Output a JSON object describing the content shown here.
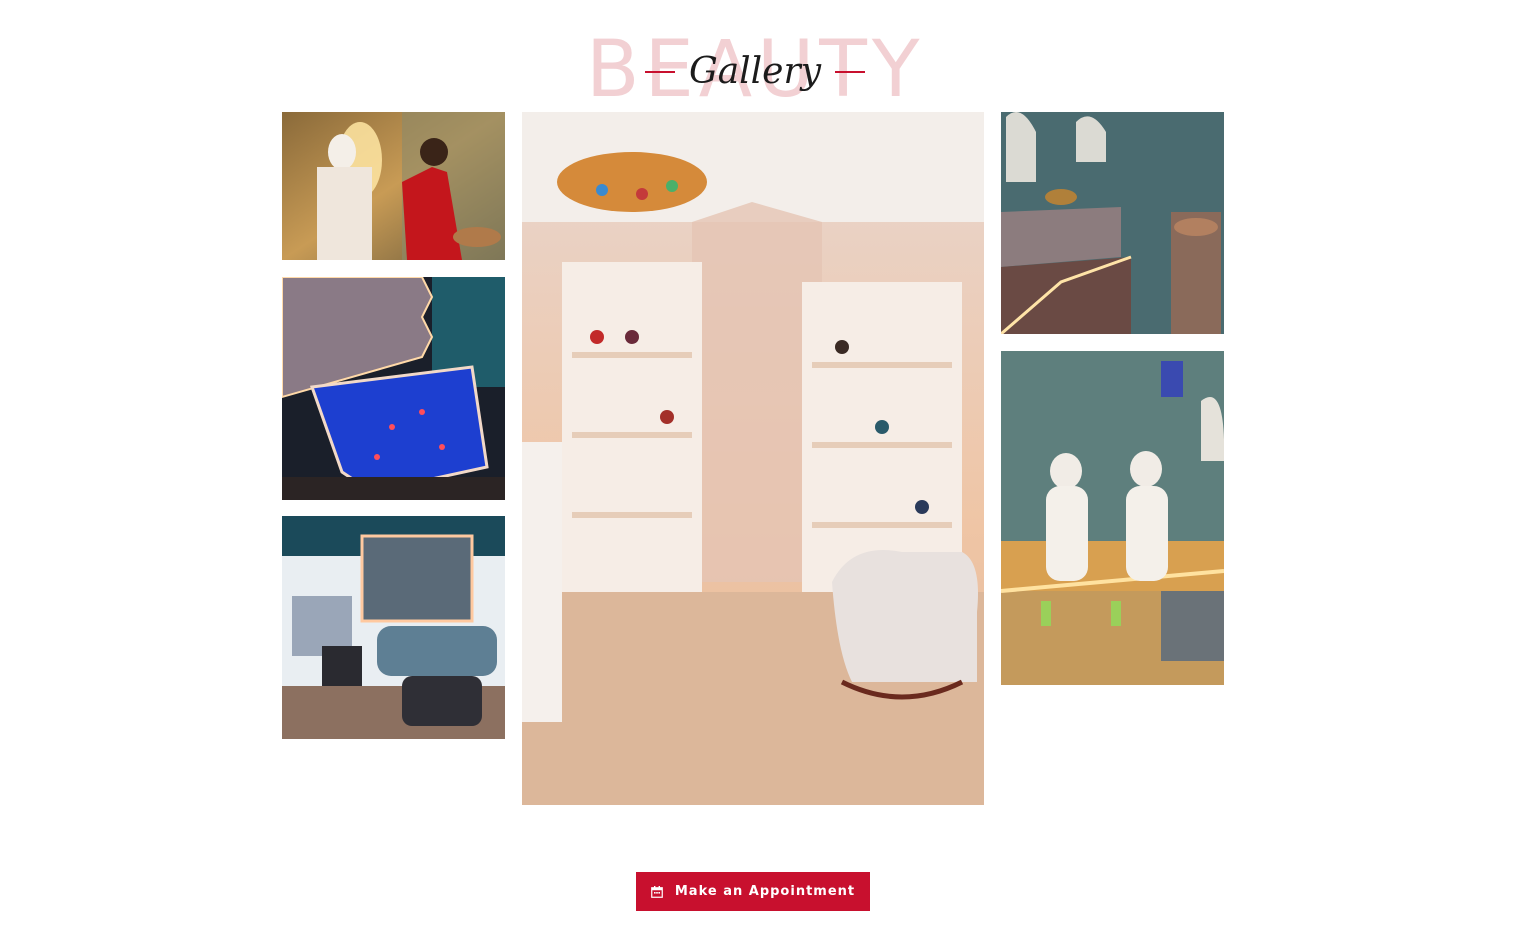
{
  "section": {
    "background_word": "BEAUTY",
    "title": "Gallery"
  },
  "gallery": {
    "images": [
      {
        "name": "treatment-massage-photo",
        "accent": "#b8752c"
      },
      {
        "name": "pool-photo",
        "accent": "#1f3fc8"
      },
      {
        "name": "facial-room-photo",
        "accent": "#4a7fa3"
      },
      {
        "name": "shop-lounge-photo",
        "accent": "#f2c7a3"
      },
      {
        "name": "hammam-room-photo",
        "accent": "#3f6d73"
      },
      {
        "name": "hammam-guests-photo",
        "accent": "#e6b64a"
      }
    ]
  },
  "cta": {
    "label": "Make an Appointment",
    "icon": "calendar-icon"
  },
  "colors": {
    "accent": "#c8102e",
    "watermark": "#f2d0d3"
  }
}
